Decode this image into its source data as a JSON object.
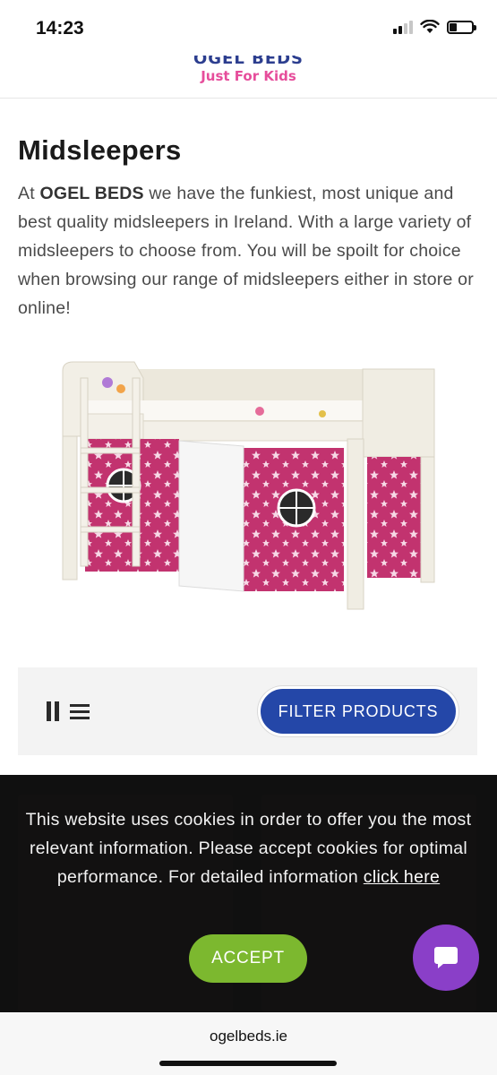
{
  "status_bar": {
    "time": "14:23",
    "signal_icon": "cellular-signal-icon",
    "wifi_icon": "wifi-icon",
    "battery_icon": "battery-icon",
    "battery_level": 0.35
  },
  "header": {
    "logo_text": "OGEL BEDS",
    "logo_tagline": "Just For Kids"
  },
  "main": {
    "title": "Midsleepers",
    "intro_prefix": "At ",
    "intro_brand": "OGEL BEDS",
    "intro_text": " we have the funkiest, most unique and best quality midsleepers in Ireland. With a large variety of midsleepers to choose from. You will be spoilt for choice when browsing our range of midsleepers either in store or online!"
  },
  "filter_bar": {
    "grid_view_icon": "grid-view-icon",
    "list_view_icon": "list-view-icon",
    "filter_label": "FILTER PRODUCTS"
  },
  "cookie_banner": {
    "message": "This website uses cookies in order to offer you the most relevant information. Please accept cookies for optimal performance. For detailed information ",
    "link_text": "click here",
    "accept_label": "ACCEPT"
  },
  "chat": {
    "icon": "chat-bubble-icon"
  },
  "browser": {
    "url": "ogelbeds.ie"
  },
  "colors": {
    "brand_blue": "#2447a8",
    "brand_pink": "#e64d9b",
    "accept_green": "#7cb82f",
    "chat_purple": "#8a3fc8"
  }
}
